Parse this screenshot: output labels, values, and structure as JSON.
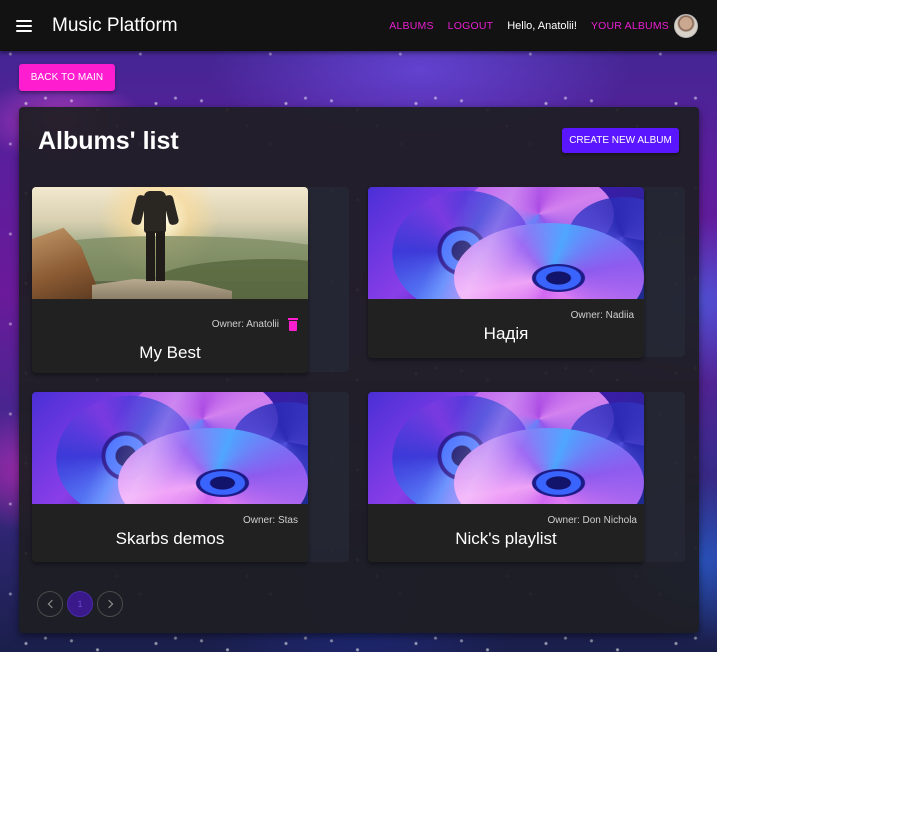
{
  "appbar": {
    "title": "Music Platform",
    "nav": {
      "albums": "ALBUMS",
      "logout": "LOGOUT",
      "greeting": "Hello, Anatolii!",
      "your_albums": "YOUR ALBUMS"
    }
  },
  "back_button": "BACK TO MAIN",
  "panel": {
    "title": "Albums' list",
    "create_button": "CREATE NEW ALBUM"
  },
  "albums": [
    {
      "owner": "Owner: Anatolii",
      "name": "My Best",
      "image": "mountain-hiker",
      "deletable": true
    },
    {
      "owner": "Owner: Nadiia",
      "name": "Надія",
      "image": "cd-discs",
      "deletable": false
    },
    {
      "owner": "Owner: Stas",
      "name": "Skarbs demos",
      "image": "cd-discs",
      "deletable": false
    },
    {
      "owner": "Owner: Don Nichola",
      "name": "Nick's playlist",
      "image": "cd-discs",
      "deletable": false
    }
  ],
  "pagination": {
    "current_page": "1",
    "prev_icon": "chevron-left-icon",
    "next_icon": "chevron-right-icon"
  },
  "colors": {
    "appbar": "#121212",
    "accent_pink": "#ff1ecf",
    "accent_violet": "#5a16ff",
    "card": "#212121"
  }
}
